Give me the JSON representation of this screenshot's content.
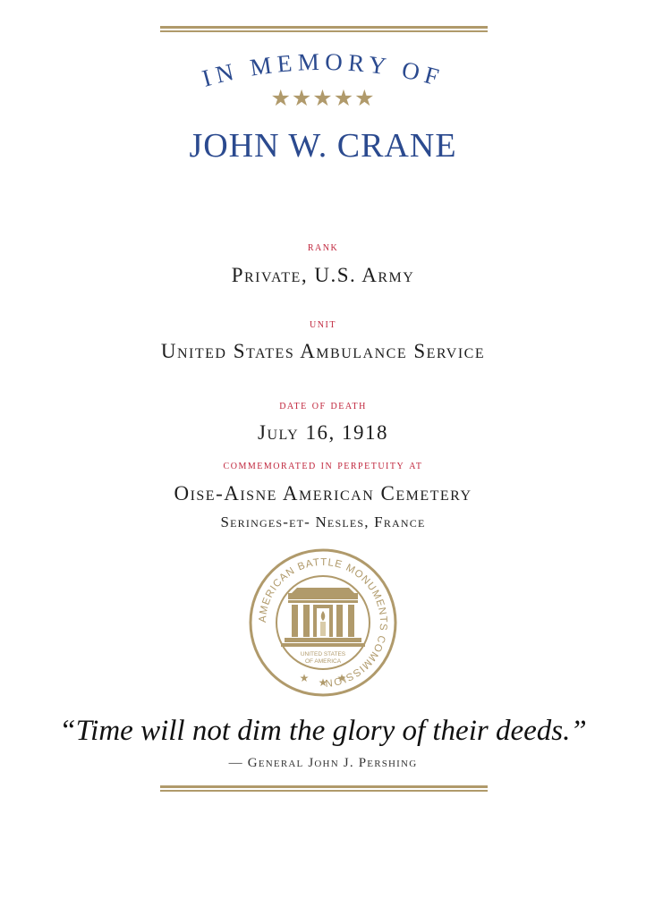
{
  "header": {
    "arc_title": "IN MEMORY OF",
    "stars": "★★★★★",
    "name": "JOHN W. CRANE"
  },
  "details": {
    "rank_label": "RANK",
    "rank_value": "Private, U.S. Army",
    "unit_label": "UNIT",
    "unit_value": "United States Ambulance Service",
    "death_label": "DATE OF DEATH",
    "death_value": "July 16, 1918",
    "commemorated_label": "COMMEMORATED IN PERPETUITY AT",
    "cemetery_name": "Oise-Aisne American Cemetery",
    "cemetery_location": "Seringes-et- Nesles, France"
  },
  "seal": {
    "ring_text": "AMERICAN BATTLE MONUMENTS COMMISSION",
    "center_text_line1": "UNITED STATES",
    "center_text_line2": "OF AMERICA"
  },
  "quote": {
    "text": "“Time will not dim the glory of their deeds.”",
    "attribution": "— General John J. Pershing"
  },
  "colors": {
    "gold": "#b09a6b",
    "blue": "#2b4a8f",
    "red": "#c0253c"
  }
}
